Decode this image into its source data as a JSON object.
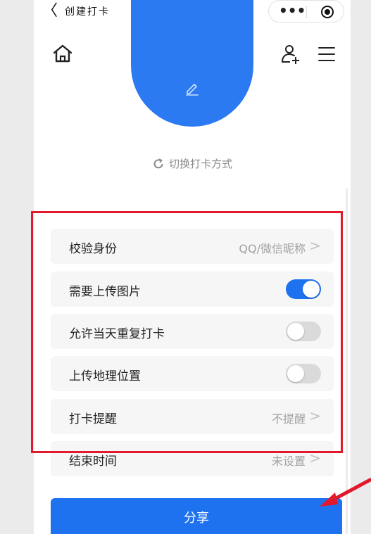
{
  "header": {
    "back_glyph": "〈",
    "title": "创建打卡",
    "more_glyph": "•••"
  },
  "icons": {
    "back": "chevron-left-icon",
    "more": "more-icon",
    "target": "target-icon",
    "home": "home-icon",
    "add_user": "user-add-icon",
    "menu": "menu-icon",
    "edit": "pencil-icon",
    "switch": "refresh-icon"
  },
  "punch": {
    "switch_label": "切换打卡方式"
  },
  "settings": {
    "verify_identity": {
      "label": "校验身份",
      "value": "QQ/微信昵称"
    },
    "upload_image": {
      "label": "需要上传图片",
      "on": true
    },
    "allow_repeat": {
      "label": "允许当天重复打卡",
      "on": false
    },
    "upload_location": {
      "label": "上传地理位置",
      "on": false
    },
    "reminder": {
      "label": "打卡提醒",
      "value": "不提醒"
    },
    "end_time": {
      "label": "结束时间",
      "value": "未设置"
    }
  },
  "actions": {
    "share_label": "分享"
  },
  "colors": {
    "accent": "#1f72ef",
    "highlight_border": "#e0192d",
    "annotation_arrow": "#e0192d"
  }
}
